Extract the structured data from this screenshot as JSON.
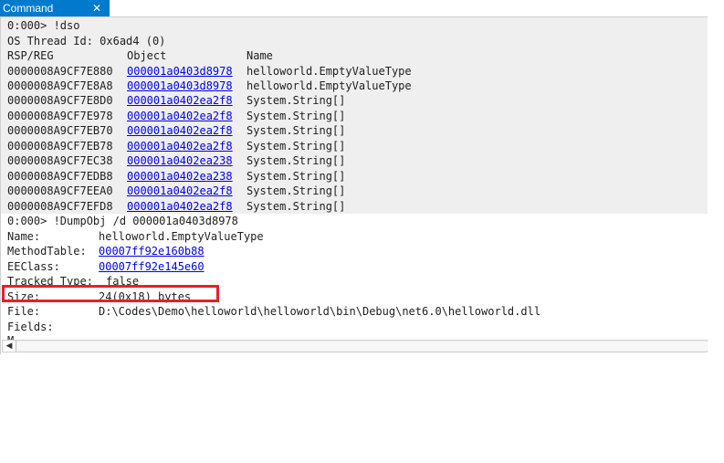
{
  "tab": {
    "title": "Command",
    "close_glyph": "✕"
  },
  "dso": {
    "prompt": "0:000> !dso",
    "thread": "OS Thread Id: 0x6ad4 (0)",
    "headers": {
      "rsp": "RSP/REG",
      "object": "Object",
      "name": "Name"
    },
    "rows": [
      {
        "rsp": "0000008A9CF7E880",
        "object": "000001a0403d8978",
        "name": "helloworld.EmptyValueType"
      },
      {
        "rsp": "0000008A9CF7E8A8",
        "object": "000001a0403d8978",
        "name": "helloworld.EmptyValueType"
      },
      {
        "rsp": "0000008A9CF7E8D0",
        "object": "000001a0402ea2f8",
        "name": "System.String[]"
      },
      {
        "rsp": "0000008A9CF7E978",
        "object": "000001a0402ea2f8",
        "name": "System.String[]"
      },
      {
        "rsp": "0000008A9CF7EB70",
        "object": "000001a0402ea2f8",
        "name": "System.String[]"
      },
      {
        "rsp": "0000008A9CF7EB78",
        "object": "000001a0402ea2f8",
        "name": "System.String[]"
      },
      {
        "rsp": "0000008A9CF7EC38",
        "object": "000001a0402ea238",
        "name": "System.String[]"
      },
      {
        "rsp": "0000008A9CF7EDB8",
        "object": "000001a0402ea238",
        "name": "System.String[]"
      },
      {
        "rsp": "0000008A9CF7EEA0",
        "object": "000001a0402ea2f8",
        "name": "System.String[]"
      },
      {
        "rsp": "0000008A9CF7EFD8",
        "object": "000001a0402ea2f8",
        "name": "System.String[]"
      }
    ]
  },
  "dumpobj": {
    "prompt": "0:000> !DumpObj /d 000001a0403d8978",
    "name_label": "Name:",
    "name_value": "helloworld.EmptyValueType",
    "methodtable_label": "MethodTable:",
    "methodtable_value": "00007ff92e160b88",
    "eeclass_label": "EEClass:",
    "eeclass_value": "00007ff92e145e60",
    "tracked_label": "Tracked Type:",
    "tracked_value": "false",
    "size_label": "Size:",
    "size_value": "24(0x18) bytes",
    "file_label": "File:",
    "file_value": "D:\\Codes\\Demo\\helloworld\\helloworld\\bin\\Debug\\net6.0\\helloworld.dll",
    "fields_label": "Fields:",
    "partial_line": "M"
  },
  "scrollbar": {
    "left_arrow": "◀"
  },
  "colors": {
    "tab_bg": "#007acc",
    "link": "#0000ee",
    "highlight": "#e8202a",
    "shaded_bg": "#efefef"
  }
}
